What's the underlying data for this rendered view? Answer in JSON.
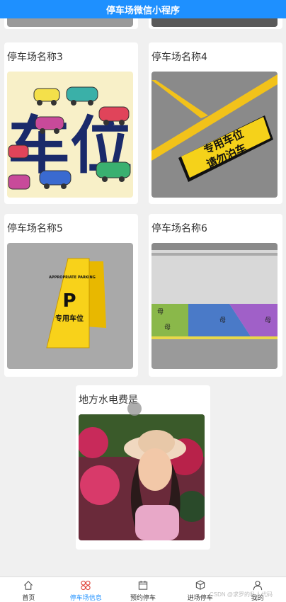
{
  "header": {
    "title": "停车场微信小程序"
  },
  "cards": [
    {
      "title": "停车场名称3"
    },
    {
      "title": "停车场名称4"
    },
    {
      "title": "停车场名称5"
    },
    {
      "title": "停车场名称6"
    },
    {
      "title": "地方水电费是"
    }
  ],
  "images": {
    "card3_text": "车位",
    "card4_sign_line1": "专用车位",
    "card4_sign_line2": "请勿泊车",
    "card5_sign_top": "APPROPRIATE PARKING",
    "card5_sign_p": "P",
    "card5_sign_text": "专用车位",
    "card6_floor_char": "母"
  },
  "tabbar": {
    "items": [
      {
        "label": "首页",
        "icon": "home-icon"
      },
      {
        "label": "停车场信息",
        "icon": "parking-info-icon"
      },
      {
        "label": "预约停车",
        "icon": "calendar-icon"
      },
      {
        "label": "进场停车",
        "icon": "car-enter-icon"
      },
      {
        "label": "我的",
        "icon": "user-icon"
      }
    ],
    "active_index": 1
  },
  "watermark": "CSDN @求罗的私人代码",
  "colors": {
    "header_bg": "#1e90ff",
    "active_tab": "#1e90ff",
    "page_bg": "#f0f0f0"
  }
}
